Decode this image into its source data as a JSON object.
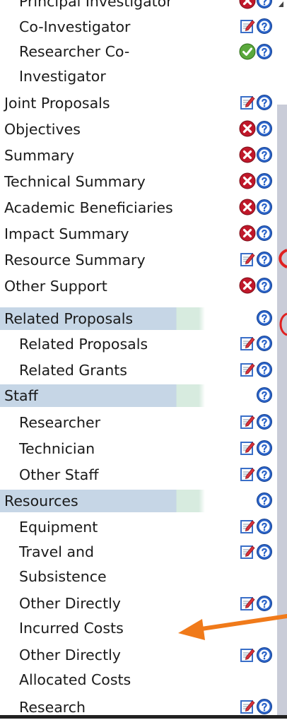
{
  "items": [
    {
      "label": "Principal Investigator",
      "indent": true,
      "icons": [
        "error-icon",
        "help-icon"
      ],
      "section": false
    },
    {
      "label": "Co-Investigator",
      "indent": true,
      "icons": [
        "edit-icon",
        "help-icon"
      ],
      "section": false
    },
    {
      "label": "Researcher Co-\nInvestigator",
      "indent": true,
      "icons": [
        "complete-icon",
        "help-icon"
      ],
      "section": false
    },
    {
      "label": "Joint Proposals",
      "indent": false,
      "icons": [
        "edit-icon",
        "help-icon"
      ],
      "section": false
    },
    {
      "label": "Objectives",
      "indent": false,
      "icons": [
        "error-icon",
        "help-icon"
      ],
      "section": false
    },
    {
      "label": "Summary",
      "indent": false,
      "icons": [
        "error-icon",
        "help-icon"
      ],
      "section": false
    },
    {
      "label": "Technical Summary",
      "indent": false,
      "icons": [
        "error-icon",
        "help-icon"
      ],
      "section": false
    },
    {
      "label": "Academic Beneficiaries",
      "indent": false,
      "icons": [
        "error-icon",
        "help-icon"
      ],
      "section": false
    },
    {
      "label": "Impact Summary",
      "indent": false,
      "icons": [
        "error-icon",
        "help-icon"
      ],
      "section": false
    },
    {
      "label": "Resource Summary",
      "indent": false,
      "icons": [
        "edit-icon",
        "help-icon"
      ],
      "section": false
    },
    {
      "label": "Other Support",
      "indent": false,
      "icons": [
        "error-icon",
        "help-icon"
      ],
      "section": false
    },
    {
      "label": "Related Proposals",
      "indent": false,
      "icons": [
        "help-icon"
      ],
      "section": true
    },
    {
      "label": "Related Proposals",
      "indent": true,
      "icons": [
        "edit-icon",
        "help-icon"
      ],
      "section": false
    },
    {
      "label": "Related Grants",
      "indent": true,
      "icons": [
        "edit-icon",
        "help-icon"
      ],
      "section": false
    },
    {
      "label": "Staff",
      "indent": false,
      "icons": [
        "help-icon"
      ],
      "section": true
    },
    {
      "label": "Researcher",
      "indent": true,
      "icons": [
        "edit-icon",
        "help-icon"
      ],
      "section": false
    },
    {
      "label": "Technician",
      "indent": true,
      "icons": [
        "edit-icon",
        "help-icon"
      ],
      "section": false
    },
    {
      "label": "Other Staff",
      "indent": true,
      "icons": [
        "edit-icon",
        "help-icon"
      ],
      "section": false
    },
    {
      "label": "Resources",
      "indent": false,
      "icons": [
        "help-icon"
      ],
      "section": true
    },
    {
      "label": "Equipment",
      "indent": true,
      "icons": [
        "edit-icon",
        "help-icon"
      ],
      "section": false
    },
    {
      "label": "Travel and\nSubsistence",
      "indent": true,
      "icons": [
        "edit-icon",
        "help-icon"
      ],
      "section": false
    },
    {
      "label": "Other Directly\nIncurred Costs",
      "indent": true,
      "icons": [
        "edit-icon",
        "help-icon"
      ],
      "section": false
    },
    {
      "label": "Other Directly\nAllocated Costs",
      "indent": true,
      "icons": [
        "edit-icon",
        "help-icon"
      ],
      "section": false
    },
    {
      "label": "Research",
      "indent": true,
      "icons": [
        "edit-icon",
        "help-icon"
      ],
      "section": false
    }
  ],
  "colors": {
    "section_band": "#c6d6e6",
    "section_band_accent": "#d7ebdf",
    "error_red": "#c0182a",
    "complete_green": "#5aa83c",
    "help_blue": "#2a63c8",
    "annotation_orange": "#f07a1a",
    "annotation_red": "#e02020"
  }
}
